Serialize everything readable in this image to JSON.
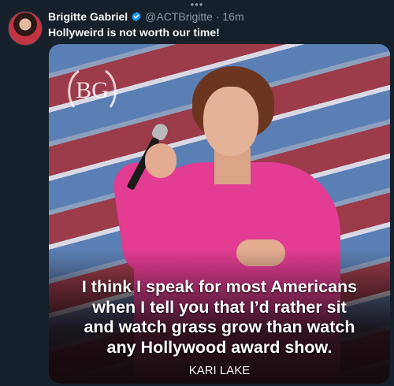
{
  "overflow_indicator": "•••",
  "tweet": {
    "author_name": "Brigitte Gabriel",
    "handle_time": "@ACTBrigitte · 16m",
    "text": "Hollyweird is not worth our time!",
    "verified": true
  },
  "media": {
    "logo_text": "BG",
    "quote_lines": [
      "I think I speak for most Americans",
      "when I tell you that I’d rather sit",
      "and watch grass grow than watch",
      "any Hollywood award show."
    ],
    "attribution": "KARI LAKE"
  },
  "colors": {
    "background": "#15202b",
    "text_primary": "#f7f9f9",
    "text_secondary": "#8b98a5",
    "verified_badge": "#1d9bf0",
    "shirt": "#e23c93"
  },
  "icons": [
    "more-dots-icon",
    "verified-badge-icon"
  ]
}
